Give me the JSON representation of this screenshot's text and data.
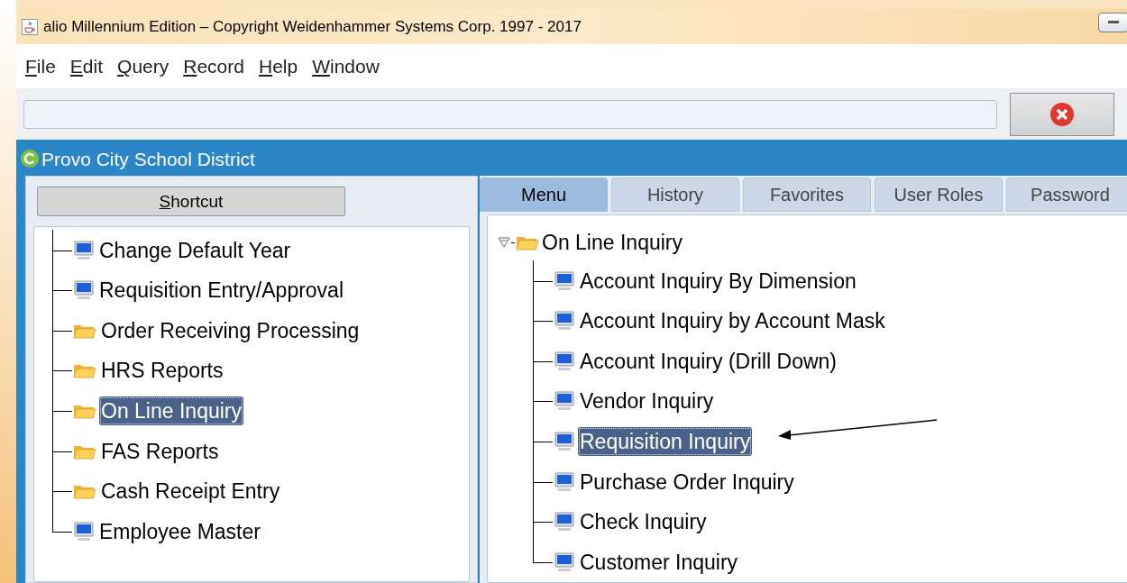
{
  "window": {
    "title": "alio Millennium Edition – Copyright Weidenhammer Systems Corp. 1997 - 2017"
  },
  "menu_bar": [
    "File",
    "Edit",
    "Query",
    "Record",
    "Help",
    "Window"
  ],
  "frame": {
    "title": "Provo City School District"
  },
  "shortcut_button": "Shortcut",
  "shortcut_tree": [
    {
      "label": "Change Default Year",
      "kind": "program",
      "selected": false
    },
    {
      "label": "Requisition Entry/Approval",
      "kind": "program",
      "selected": false
    },
    {
      "label": "Order Receiving Processing",
      "kind": "folder",
      "selected": false
    },
    {
      "label": "HRS Reports",
      "kind": "folder",
      "selected": false
    },
    {
      "label": "On Line Inquiry",
      "kind": "folder",
      "selected": true
    },
    {
      "label": "FAS Reports",
      "kind": "folder",
      "selected": false
    },
    {
      "label": "Cash Receipt Entry",
      "kind": "folder",
      "selected": false
    },
    {
      "label": "Employee Master",
      "kind": "program",
      "selected": false
    }
  ],
  "tabs": [
    {
      "label": "Menu",
      "selected": true
    },
    {
      "label": "History",
      "selected": false
    },
    {
      "label": "Favorites",
      "selected": false
    },
    {
      "label": "User Roles",
      "selected": false
    },
    {
      "label": "Password",
      "selected": false
    }
  ],
  "menu_tree": {
    "label": "On Line Inquiry",
    "kind": "folder",
    "expanded": true,
    "children": [
      {
        "label": "Account Inquiry By Dimension",
        "kind": "program",
        "selected": false
      },
      {
        "label": "Account Inquiry by Account Mask",
        "kind": "program",
        "selected": false
      },
      {
        "label": "Account Inquiry (Drill Down)",
        "kind": "program",
        "selected": false
      },
      {
        "label": "Vendor Inquiry",
        "kind": "program",
        "selected": false
      },
      {
        "label": "Requisition Inquiry",
        "kind": "program",
        "selected": true
      },
      {
        "label": "Purchase Order Inquiry",
        "kind": "program",
        "selected": false
      },
      {
        "label": "Check Inquiry",
        "kind": "program",
        "selected": false
      },
      {
        "label": "Customer Inquiry",
        "kind": "program",
        "selected": false
      }
    ]
  }
}
